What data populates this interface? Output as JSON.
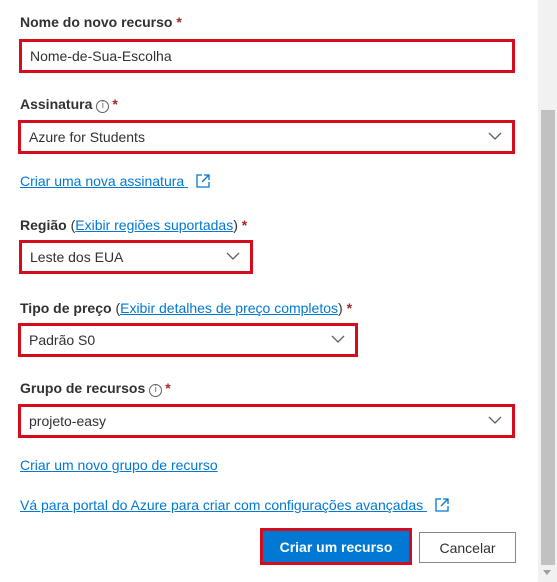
{
  "resource_name": {
    "label": "Nome do novo recurso",
    "required": "*",
    "value": "Nome-de-Sua-Escolha"
  },
  "subscription": {
    "label": "Assinatura",
    "info": "i",
    "required": "*",
    "value": "Azure for Students",
    "create_link": "Criar uma nova assinatura"
  },
  "region": {
    "label": "Região",
    "open_paren": "(",
    "link": "Exibir regiões suportadas",
    "close_paren": ")",
    "required": "*",
    "value": "Leste dos EUA"
  },
  "pricing": {
    "label": "Tipo de preço",
    "open_paren": "(",
    "link": "Exibir detalhes de preço completos",
    "close_paren": ")",
    "required": "*",
    "value": "Padrão S0"
  },
  "resource_group": {
    "label": "Grupo de recursos",
    "info": "i",
    "required": "*",
    "value": "projeto-easy",
    "create_link": "Criar um novo grupo de recurso"
  },
  "portal_link": "Vá para portal do Azure para criar com configurações avançadas",
  "buttons": {
    "create": "Criar um recurso",
    "cancel": "Cancelar"
  },
  "colors": {
    "highlight": "#d40d1d",
    "accent": "#0078d4",
    "required": "#a4262c"
  },
  "icons": {
    "dropdown": "chevron-down-icon",
    "external": "external-link-icon",
    "info": "info-icon"
  }
}
